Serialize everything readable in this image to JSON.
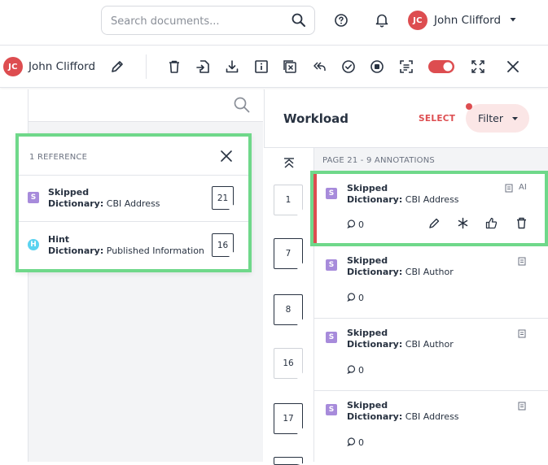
{
  "top": {
    "search_placeholder": "Search documents...",
    "user_initials": "JC",
    "user_name": "John Clifford"
  },
  "toolbar": {
    "user_initials": "JC",
    "user_name": "John Clifford",
    "toggle_on": true
  },
  "reference": {
    "title": "1 REFERENCE",
    "items": [
      {
        "badge": "S",
        "type": "Skipped",
        "dict_label": "Dictionary:",
        "dict_value": "CBI Address",
        "page": "21"
      },
      {
        "badge": "H",
        "type": "Hint",
        "dict_label": "Dictionary:",
        "dict_value": "Published Information",
        "page": "16"
      }
    ]
  },
  "workload": {
    "title": "Workload",
    "select_label": "SELECT",
    "filter_label": "Filter",
    "page_header": "PAGE 21 - 9 ANNOTATIONS",
    "thumbs": [
      "1",
      "7",
      "8",
      "16",
      "17"
    ],
    "annotations": [
      {
        "badge": "S",
        "type": "Skipped",
        "dict_label": "Dictionary:",
        "dict_value": "CBI Address",
        "ai_label": "AI",
        "comments": "0"
      },
      {
        "badge": "S",
        "type": "Skipped",
        "dict_label": "Dictionary:",
        "dict_value": "CBI Author",
        "comments": "0"
      },
      {
        "badge": "S",
        "type": "Skipped",
        "dict_label": "Dictionary:",
        "dict_value": "CBI Author",
        "comments": "0"
      },
      {
        "badge": "S",
        "type": "Skipped",
        "dict_label": "Dictionary:",
        "dict_value": "CBI Address",
        "comments": "0"
      }
    ]
  },
  "colors": {
    "accent": "#dd4d50",
    "highlight": "#6fd88a",
    "badge_skipped": "#a78bdb",
    "badge_hint": "#5bd3f0"
  }
}
